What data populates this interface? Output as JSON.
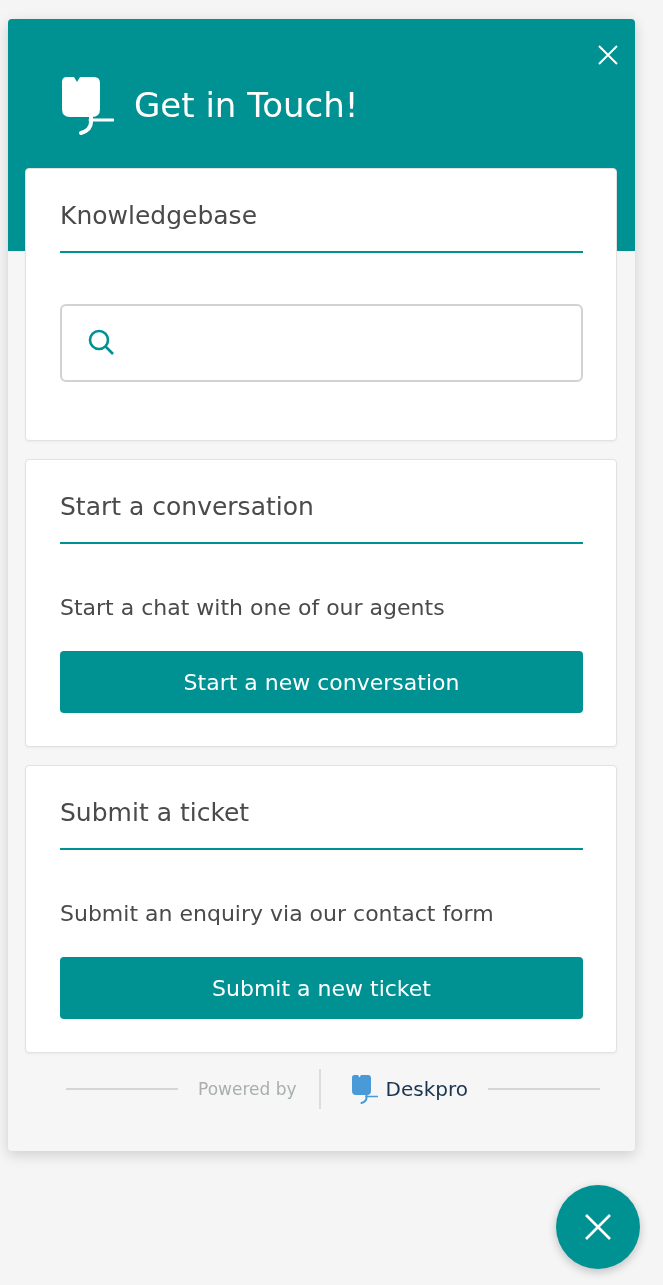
{
  "header": {
    "title": "Get in Touch!"
  },
  "sections": [
    {
      "kind": "search",
      "title": "Knowledgebase"
    },
    {
      "kind": "action",
      "title": "Start a conversation",
      "description": "Start a chat with one of our agents",
      "button": "Start a new conversation"
    },
    {
      "kind": "action",
      "title": "Submit a ticket",
      "description": "Submit an enquiry via our contact form",
      "button": "Submit a new ticket"
    }
  ],
  "footer": {
    "powered_by": "Powered by",
    "brand": "Deskpro"
  }
}
